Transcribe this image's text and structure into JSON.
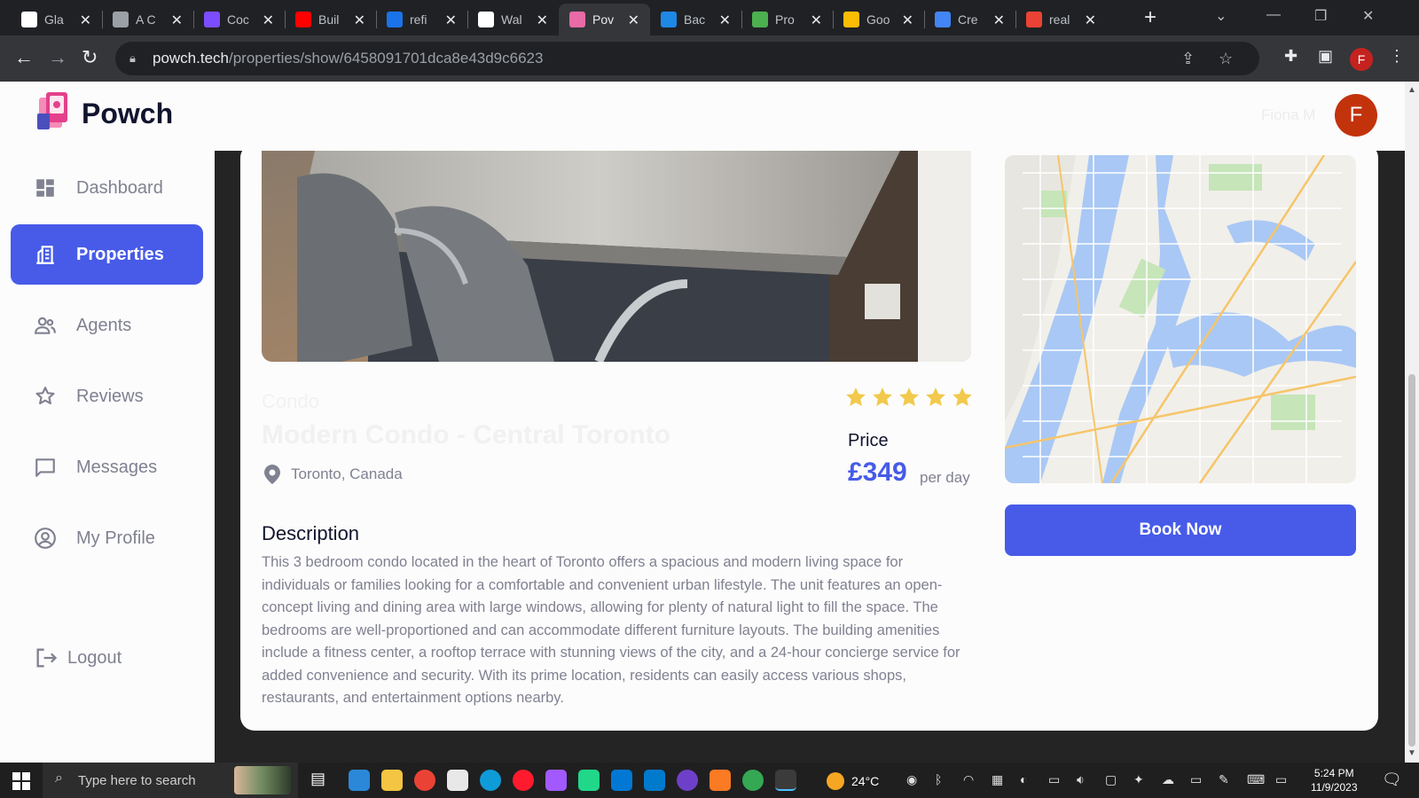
{
  "browser": {
    "tabs": [
      {
        "label": "Gla",
        "favicon": "glassdoor-icon",
        "color": "#ffffff"
      },
      {
        "label": "A C",
        "favicon": "globe-icon",
        "color": "#9aa0a6"
      },
      {
        "label": "Coc",
        "favicon": "code-icon",
        "color": "#7c4dff"
      },
      {
        "label": "Buil",
        "favicon": "youtube-icon",
        "color": "#ff0000"
      },
      {
        "label": "refi",
        "favicon": "phone-icon",
        "color": "#1a73e8"
      },
      {
        "label": "Wal",
        "favicon": "github-icon",
        "color": "#ffffff"
      },
      {
        "label": "Pov",
        "favicon": "powch-icon",
        "color": "#e86aa6",
        "active": true
      },
      {
        "label": "Bac",
        "favicon": "mui-icon",
        "color": "#1e88e5"
      },
      {
        "label": "Pro",
        "favicon": "mongodb-icon",
        "color": "#4caf50"
      },
      {
        "label": "Goo",
        "favicon": "google-cloud-icon",
        "color": "#fbbc04"
      },
      {
        "label": "Cre",
        "favicon": "api-icon",
        "color": "#4285f4"
      },
      {
        "label": "real",
        "favicon": "google-icon",
        "color": "#ea4335"
      }
    ],
    "new_tab": "+",
    "url_host": "powch.tech",
    "url_path": "/properties/show/6458091701dca8e43d9c6623",
    "profile_initial": "F"
  },
  "app": {
    "brand": "Powch",
    "user_name": "Fiona M",
    "avatar_initial": "F",
    "nav": [
      {
        "label": "Dashboard",
        "icon": "dashboard-icon",
        "active": false
      },
      {
        "label": "Properties",
        "icon": "building-icon",
        "active": true
      },
      {
        "label": "Agents",
        "icon": "people-icon",
        "active": false
      },
      {
        "label": "Reviews",
        "icon": "star-outline-icon",
        "active": false
      },
      {
        "label": "Messages",
        "icon": "chat-icon",
        "active": false
      },
      {
        "label": "My Profile",
        "icon": "account-circle-icon",
        "active": false
      }
    ],
    "logout_label": "Logout",
    "collapse_glyph": "‹",
    "accent_color": "#475be8"
  },
  "property": {
    "type": "Condo",
    "title": "Modern Condo - Central Toronto",
    "location": "Toronto, Canada",
    "rating": 5,
    "rating_max": 5,
    "price_label": "Price",
    "price": "£349",
    "price_unit": "per day",
    "book_label": "Book Now",
    "description_heading": "Description",
    "description": "This 3 bedroom condo located in the heart of Toronto offers a spacious and modern living space for individuals or families looking for a comfortable and convenient urban lifestyle. The unit features an open-concept living and dining area with large windows, allowing for plenty of natural light to fill the space. The bedrooms are well-proportioned and can accommodate different furniture layouts. The building amenities include a fitness center, a rooftop terrace with stunning views of the city, and a 24-hour concierge service for added convenience and security. With its prime location, residents can easily access various shops, restaurants, and entertainment options nearby."
  },
  "taskbar": {
    "search_placeholder": "Type here to search",
    "weather": "24°C",
    "time": "5:24 PM",
    "date": "11/9/2023"
  }
}
